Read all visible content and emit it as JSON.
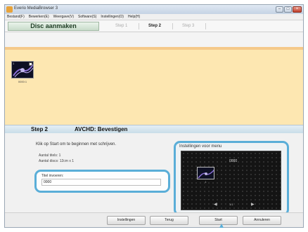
{
  "window": {
    "title": "Everio MediaBrowser 3",
    "controls": {
      "minimize": "–",
      "maximize": "□",
      "close": "×"
    }
  },
  "menu": [
    "Bestand(F)",
    "Bewerken(E)",
    "Weergave(V)",
    "Software(S)",
    "Instellingen(O)",
    "Help(H)"
  ],
  "stepbar": {
    "create_label": "Disc aanmaken",
    "steps": [
      "Step 1",
      "Step 2",
      "Step 3"
    ],
    "active_step": "Step 2"
  },
  "selection": {
    "thumbnail_number": "1",
    "thumbnail_label": "0000:1"
  },
  "step2": {
    "number": "Step 2",
    "title": "AVCHD: Bevestigen"
  },
  "details": {
    "instruction": "Klik op Start om te beginnen met schrijven.",
    "file_count": "Aantal titels: 1",
    "disc_count": "Aantal discs: 12cm x 1",
    "title_label": "Titel invoeren:",
    "title_value": "0000"
  },
  "preview": {
    "label": "Instellingen voor menu",
    "menu_title": "0000",
    "thumb_caption": "1",
    "page": "1/1"
  },
  "buttons": {
    "settings": "Instellingen",
    "back": "Terug",
    "start": "Start",
    "cancel": "Annuleren"
  }
}
